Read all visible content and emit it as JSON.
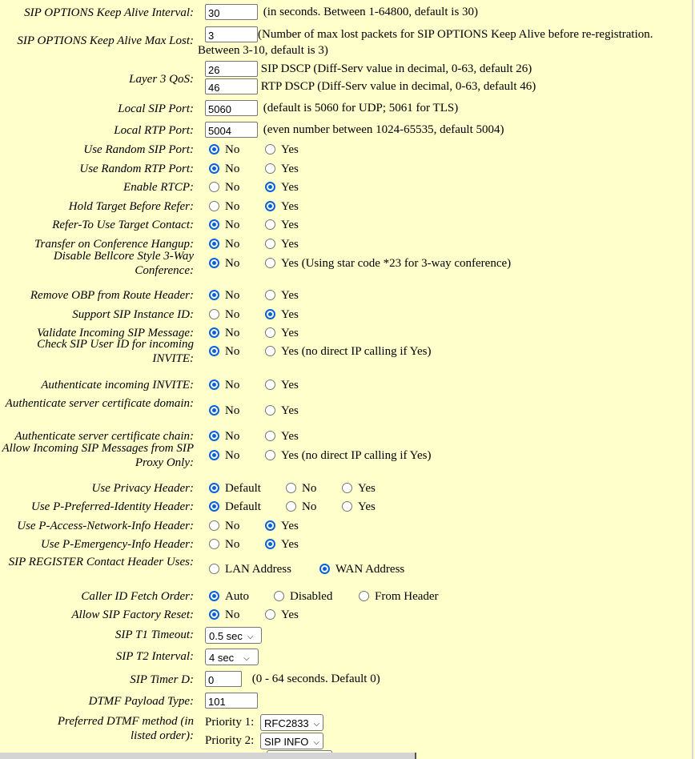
{
  "fields": {
    "keepalive_interval": {
      "label": "SIP OPTIONS Keep Alive Interval:",
      "value": "30",
      "note": "(in seconds. Between 1-64800, default is 30)"
    },
    "keepalive_max_lost": {
      "label": "SIP OPTIONS Keep Alive Max Lost:",
      "value": "3",
      "note": "(Number of max lost packets for SIP OPTIONS Keep Alive before re-registration.",
      "note2": "Between 3-10, default is 3)"
    },
    "layer3_qos": {
      "label": "Layer 3 QoS:",
      "sip_value": "26",
      "sip_note": "SIP DSCP (Diff-Serv value in decimal, 0-63, default 26)",
      "rtp_value": "46",
      "rtp_note": "RTP DSCP (Diff-Serv value in decimal, 0-63, default 46)"
    },
    "local_sip_port": {
      "label": "Local SIP Port:",
      "value": "5060",
      "note": "(default is 5060 for UDP; 5061 for TLS)"
    },
    "local_rtp_port": {
      "label": "Local RTP Port:",
      "value": "5004",
      "note": "(even number between 1024-65535, default 5004)"
    }
  },
  "radios": [
    {
      "label": "Use Random SIP Port:",
      "options": [
        "No",
        "Yes"
      ],
      "selected": 0
    },
    {
      "label": "Use Random RTP Port:",
      "options": [
        "No",
        "Yes"
      ],
      "selected": 0
    },
    {
      "label": "Enable RTCP:",
      "options": [
        "No",
        "Yes"
      ],
      "selected": 1
    },
    {
      "label": "Hold Target Before Refer:",
      "options": [
        "No",
        "Yes"
      ],
      "selected": 1
    },
    {
      "label": "Refer-To Use Target Contact:",
      "options": [
        "No",
        "Yes"
      ],
      "selected": 0
    },
    {
      "label": "Transfer on Conference Hangup:",
      "options": [
        "No",
        "Yes"
      ],
      "selected": 0
    },
    {
      "label": "Disable Bellcore Style 3-Way Conference:",
      "options": [
        "No",
        "Yes (Using star code *23 for 3-way conference)"
      ],
      "selected": 0
    },
    {
      "label": "Remove OBP from Route Header:",
      "options": [
        "No",
        "Yes"
      ],
      "selected": 0
    },
    {
      "label": "Support SIP Instance ID:",
      "options": [
        "No",
        "Yes"
      ],
      "selected": 1
    },
    {
      "label": "Validate Incoming SIP Message:",
      "options": [
        "No",
        "Yes"
      ],
      "selected": 0
    },
    {
      "label": "Check SIP User ID for incoming INVITE:",
      "options": [
        "No",
        "Yes (no direct IP calling if Yes)"
      ],
      "selected": 0
    },
    {
      "label": "Authenticate incoming INVITE:",
      "options": [
        "No",
        "Yes"
      ],
      "selected": 0
    },
    {
      "label": "Authenticate server certificate domain:",
      "options": [
        "No",
        "Yes"
      ],
      "selected": 0
    },
    {
      "label": "Authenticate server certificate chain:",
      "options": [
        "No",
        "Yes"
      ],
      "selected": 0
    },
    {
      "label": "Allow Incoming SIP Messages from SIP Proxy Only:",
      "options": [
        "No",
        "Yes (no direct IP calling if Yes)"
      ],
      "selected": 0
    },
    {
      "label": "Use Privacy Header:",
      "options": [
        "Default",
        "No",
        "Yes"
      ],
      "selected": 0
    },
    {
      "label": "Use P-Preferred-Identity Header:",
      "options": [
        "Default",
        "No",
        "Yes"
      ],
      "selected": 0
    },
    {
      "label": "Use P-Access-Network-Info Header:",
      "options": [
        "No",
        "Yes"
      ],
      "selected": 1
    },
    {
      "label": "Use P-Emergency-Info Header:",
      "options": [
        "No",
        "Yes"
      ],
      "selected": 1
    },
    {
      "label": "SIP REGISTER Contact Header Uses:",
      "options": [
        "LAN Address",
        "WAN Address"
      ],
      "selected": 1
    },
    {
      "label": "Caller ID Fetch Order:",
      "options": [
        "Auto",
        "Disabled",
        "From Header"
      ],
      "selected": 0
    },
    {
      "label": "Allow SIP Factory Reset:",
      "options": [
        "No",
        "Yes"
      ],
      "selected": 0
    }
  ],
  "timers": {
    "t1": {
      "label": "SIP T1 Timeout:",
      "value": "0.5 sec"
    },
    "t2": {
      "label": "SIP T2 Interval:",
      "value": "4 sec"
    },
    "timer_d": {
      "label": "SIP Timer D:",
      "value": "0",
      "note": "(0 - 64 seconds. Default 0)"
    },
    "dtmf_payload": {
      "label": "DTMF Payload Type:",
      "value": "101"
    }
  },
  "dtmf_method": {
    "label": "Preferred DTMF method (in listed order):",
    "priorities": [
      {
        "label": "Priority 1:",
        "value": "RFC2833"
      },
      {
        "label": "Priority 2:",
        "value": "SIP INFO"
      }
    ]
  }
}
